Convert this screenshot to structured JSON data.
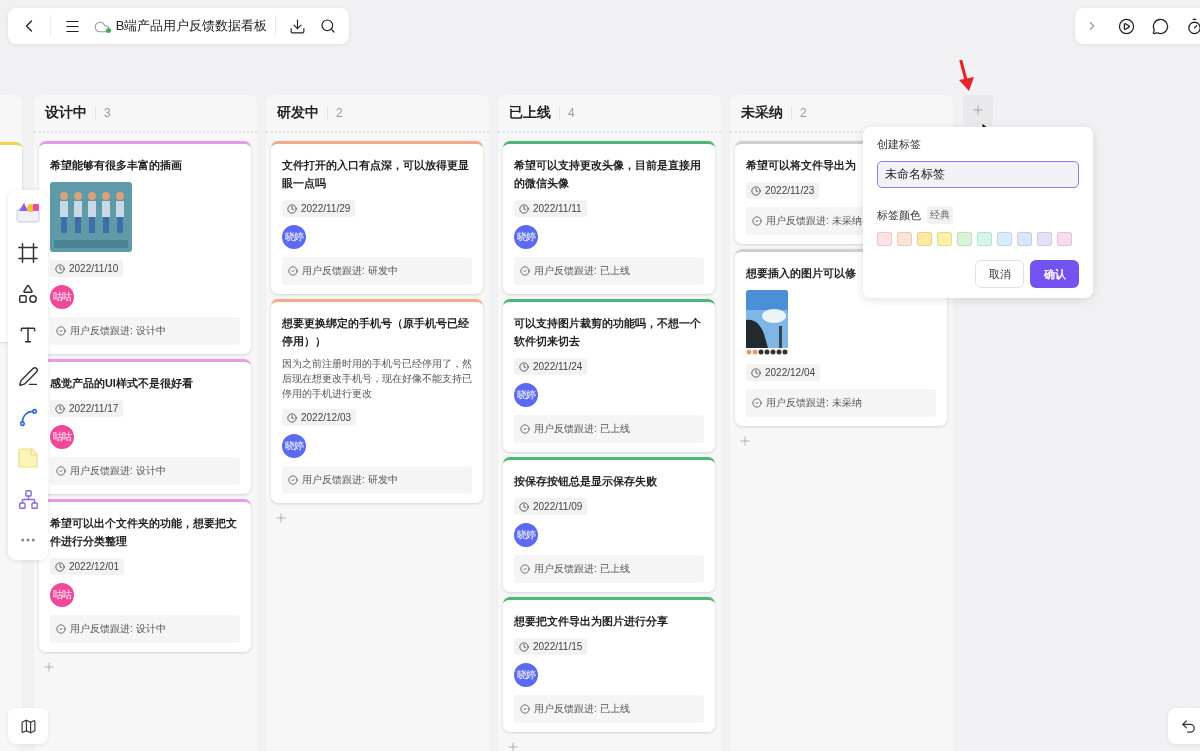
{
  "top_bar": {
    "title": "B端产品用户反馈数据看板"
  },
  "columns": [
    {
      "title": "设计中",
      "count": "3",
      "color": "#e59be8",
      "cards": [
        {
          "title": "希望能够有很多丰富的插画",
          "date": "2022/11/10",
          "assignee": {
            "name": "咕咕",
            "color": "#f0479b"
          },
          "status": "用户反馈跟进: 设计中"
        },
        {
          "title": "感觉产品的UI样式不是很好看",
          "date": "2022/11/17",
          "assignee": {
            "name": "咕咕",
            "color": "#f0479b"
          },
          "status": "用户反馈跟进: 设计中"
        },
        {
          "title": "希望可以出个文件夹的功能，想要把文件进行分类整理",
          "date": "2022/12/01",
          "assignee": {
            "name": "咕咕",
            "color": "#f0479b"
          },
          "status": "用户反馈跟进: 设计中"
        }
      ]
    },
    {
      "title": "研发中",
      "count": "2",
      "color": "#f3a98b",
      "cards": [
        {
          "title": "文件打开的入口有点深，可以放得更显眼一点吗",
          "date": "2022/11/29",
          "assignee": {
            "name": "晓婷",
            "color": "#5b6af0"
          },
          "status": "用户反馈跟进: 研发中"
        },
        {
          "title": "想要更换绑定的手机号（原手机号已经停用））",
          "description": "因为之前注册时用的手机号已经停用了，然后现在想更改手机号，现在好像不能支持已停用的手机进行更改",
          "date": "2022/12/03",
          "assignee": {
            "name": "晓婷",
            "color": "#5b6af0"
          },
          "status": "用户反馈跟进: 研发中"
        }
      ]
    },
    {
      "title": "已上线",
      "count": "4",
      "color": "#4cb877",
      "cards": [
        {
          "title": "希望可以支持更改头像，目前是直接用的微信头像",
          "date": "2022/11/11",
          "assignee": {
            "name": "晓婷",
            "color": "#5b6af0"
          },
          "status": "用户反馈跟进: 已上线"
        },
        {
          "title": "可以支持图片裁剪的功能吗，不想一个软件切来切去",
          "date": "2022/11/24",
          "assignee": {
            "name": "晓婷",
            "color": "#5b6af0"
          },
          "status": "用户反馈跟进: 已上线"
        },
        {
          "title": "按保存按钮总是显示保存失败",
          "date": "2022/11/09",
          "assignee": {
            "name": "晓婷",
            "color": "#5b6af0"
          },
          "status": "用户反馈跟进: 已上线"
        },
        {
          "title": "想要把文件导出为图片进行分享",
          "date": "2022/11/15",
          "assignee": {
            "name": "晓婷",
            "color": "#5b6af0"
          },
          "status": "用户反馈跟进: 已上线"
        }
      ]
    },
    {
      "title": "未采纳",
      "count": "2",
      "color": "#cfcfd3",
      "cards": [
        {
          "title": "希望可以将文件导出为",
          "date": "2022/11/23",
          "status": "用户反馈跟进: 未采纳"
        },
        {
          "title": "想要插入的图片可以修",
          "date": "2022/12/04",
          "status": "用户反馈跟进: 未采纳"
        }
      ]
    }
  ],
  "tag_popover": {
    "title": "创建标签",
    "name_field": {
      "value": "未命名标签"
    },
    "color_label": "标签颜色",
    "color_badge": "经典",
    "swatches": [
      {
        "color": "#fde1e4"
      },
      {
        "color": "#fde3d6"
      },
      {
        "color": "#fde9a3"
      },
      {
        "color": "#fbf2a8"
      },
      {
        "color": "#d8f5d8"
      },
      {
        "color": "#d5f6ea"
      },
      {
        "color": "#d8eefc"
      },
      {
        "color": "#dbe5fc"
      },
      {
        "color": "#e5e1fc"
      },
      {
        "color": "#f9dbf0"
      }
    ],
    "buttons": [
      {
        "label": "取消",
        "kind": "secondary"
      },
      {
        "label": "确认",
        "kind": "primary"
      }
    ]
  }
}
